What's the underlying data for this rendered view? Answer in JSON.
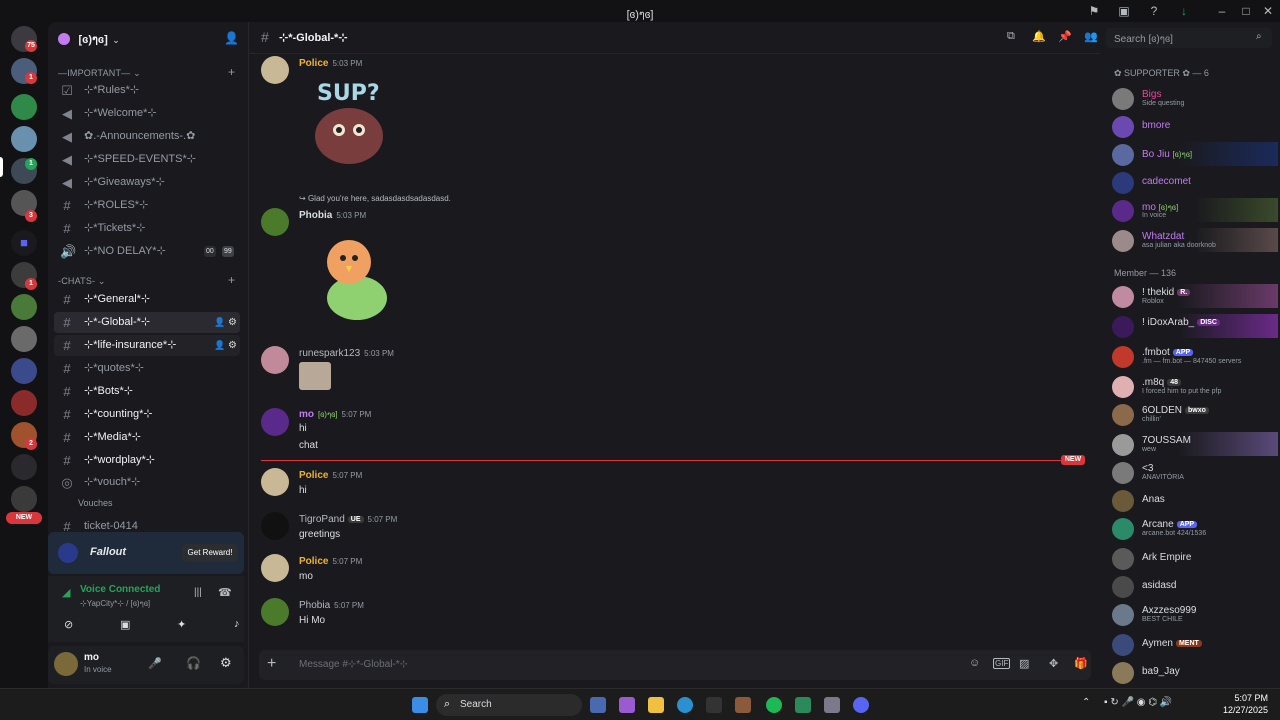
{
  "window": {
    "title": "[ɞ)ๆɞ]"
  },
  "guilds": {
    "home_badge": "75",
    "badges": [
      "1",
      "1",
      "3",
      "1",
      "2"
    ],
    "new_label": "NEW"
  },
  "server": {
    "name": "[ɞ)ๆɞ]"
  },
  "categories": {
    "important": "—IMPORTANT—",
    "chats": "-CHATS-"
  },
  "channels": [
    {
      "label": "⊹*Rules*⊹",
      "icon": "rules-icon"
    },
    {
      "label": "⊹*Welcome*⊹",
      "icon": "announcement-icon"
    },
    {
      "label": "✿.-Announcements-.✿",
      "icon": "announcement-icon"
    },
    {
      "label": "⊹*SPEED-EVENTS*⊹",
      "icon": "announcement-icon"
    },
    {
      "label": "⊹*Giveaways*⊹",
      "icon": "announcement-icon"
    },
    {
      "label": "⊹*ROLES*⊹",
      "icon": "hash-icon"
    },
    {
      "label": "⊹*Tickets*⊹",
      "icon": "hash-icon"
    },
    {
      "label": "⊹*NO DELAY*⊹",
      "icon": "voice-icon",
      "count1": "00",
      "count2": "99"
    }
  ],
  "chat_channels": [
    {
      "label": "⊹*General*⊹"
    },
    {
      "label": "⊹*-Global-*⊹"
    },
    {
      "label": "⊹*life-insurance*⊹"
    },
    {
      "label": "⊹*quotes*⊹"
    },
    {
      "label": "⊹*Bots*⊹"
    },
    {
      "label": "⊹*counting*⊹"
    },
    {
      "label": "⊹*Media*⊹"
    },
    {
      "label": "⊹*wordplay*⊹"
    },
    {
      "label": "⊹*vouch*⊹"
    },
    {
      "label": "Vouches"
    },
    {
      "label": "ticket-0414"
    }
  ],
  "promo": {
    "game": "Fallout",
    "button": "Get Reward!"
  },
  "voice": {
    "status": "Voice Connected",
    "channel": "⊹YapCity*⊹ / [ɞ)ๆɞ]"
  },
  "user": {
    "name": "mo",
    "status": "In voice"
  },
  "header": {
    "channel": "⊹*-Global-*⊹",
    "search_placeholder": "Search [ɞ)ๆɞ]"
  },
  "messages": [
    {
      "author": "Police",
      "time": "5:03 PM",
      "color": "#f0b232",
      "sticker": "SUP?"
    },
    {
      "reply": "Glad you're here, sadasdasdsadasdasd.",
      "author": "Phobia",
      "time": "5:03 PM",
      "color": "#dbdee1"
    },
    {
      "author": "runespark123",
      "time": "5:03 PM",
      "color": "#dbdee1"
    },
    {
      "author": "mo",
      "time": "5:07 PM",
      "color": "#c27cf0",
      "tagline": "[ɞ)ๆɞ]",
      "lines": [
        "hi",
        "chat"
      ]
    },
    {
      "author": "Police",
      "time": "5:07 PM",
      "color": "#f0b232",
      "lines": [
        "hi"
      ]
    },
    {
      "author": "TigroPand",
      "time": "5:07 PM",
      "color": "#dbdee1",
      "tag": "UE",
      "lines": [
        "greetings"
      ]
    },
    {
      "author": "Police",
      "time": "5:07 PM",
      "color": "#f0b232",
      "lines": [
        "mo"
      ]
    },
    {
      "author": "Phobia",
      "time": "5:07 PM",
      "color": "#dbdee1",
      "lines": [
        "Hi Mo"
      ]
    }
  ],
  "new_divider": "NEW",
  "composer": {
    "placeholder": "Message #⊹*-Global-*⊹"
  },
  "member_groups": [
    {
      "title": "✿ SUPPORTER ✿ — 6"
    },
    {
      "title": "Member — 136"
    }
  ],
  "supporters": [
    {
      "name": "Bigs",
      "status": "Side questing",
      "color": "#eb459e"
    },
    {
      "name": "bmore",
      "status": "",
      "color": "#c27cf0"
    },
    {
      "name": "Bo Jiu",
      "status": "",
      "color": "#c27cf0",
      "extra": "[ɞ)ๆɞ]"
    },
    {
      "name": "cadecomet",
      "status": "",
      "color": "#c27cf0"
    },
    {
      "name": "mo",
      "status": "In voice",
      "color": "#c27cf0",
      "extra": "[ɞ)ๆɞ]"
    },
    {
      "name": "Whatzdat",
      "status": "asa julian aka doorknob",
      "color": "#c27cf0"
    }
  ],
  "members": [
    {
      "name": "! thekid",
      "status": "Roblox",
      "tag": "R."
    },
    {
      "name": "! iDoxArab_",
      "status": "",
      "tag": "DISC"
    },
    {
      "name": ".fmbot",
      "status": ".fm — fm.bot — 847450 servers",
      "tag": "APP"
    },
    {
      "name": ".m8q",
      "status": "I forced him to put the pfp",
      "tag": "48"
    },
    {
      "name": "6OLDEN",
      "status": "chillin'",
      "tag": "bwxo"
    },
    {
      "name": "7OUSSAM",
      "status": "wew",
      "tag": ""
    },
    {
      "name": "<3",
      "status": "ANAVITÓRIA",
      "tag": ""
    },
    {
      "name": "Anas",
      "status": "",
      "tag": ""
    },
    {
      "name": "Arcane",
      "status": "arcane.bot 424/1536",
      "tag": "APP"
    },
    {
      "name": "Ark Empire",
      "status": "",
      "tag": ""
    },
    {
      "name": "asidasd",
      "status": "",
      "tag": ""
    },
    {
      "name": "Axzzeso999",
      "status": "BEST CHILE",
      "tag": ""
    },
    {
      "name": "Aymen",
      "status": "",
      "tag": "MENT"
    },
    {
      "name": "ba9_Jay",
      "status": "",
      "tag": ""
    }
  ],
  "taskbar": {
    "search": "Search",
    "time": "5:07 PM",
    "date": "12/27/2025"
  }
}
